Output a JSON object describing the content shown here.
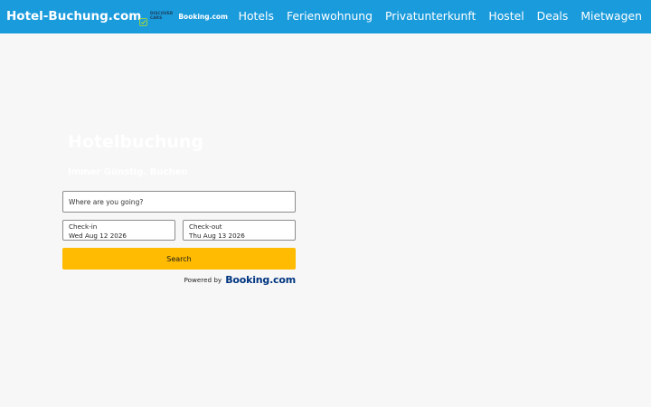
{
  "header": {
    "brand": "Hotel-Buchung.com",
    "partner_logo": {
      "discover_line1": "DISCOVER",
      "discover_line2": "CARS",
      "booking_word": "Booking",
      "booking_suffix": ".com"
    },
    "nav": [
      {
        "label": "Hotels"
      },
      {
        "label": "Ferienwohnung"
      },
      {
        "label": "Privatunterkunft"
      },
      {
        "label": "Hostel"
      },
      {
        "label": "Deals"
      },
      {
        "label": "Mietwagen"
      }
    ],
    "colors": {
      "bar": "#1a9bdc",
      "text": "#ffffff"
    }
  },
  "hero": {
    "title": "Hotelbuchung",
    "subtitle": "Immer Günstig. Buchen"
  },
  "search_form": {
    "destination": {
      "placeholder": "Where are you going?",
      "value": ""
    },
    "checkin": {
      "label": "Check-in",
      "value": "Wed Aug 12 2026"
    },
    "checkout": {
      "label": "Check-out",
      "value": "Thu Aug 13 2026"
    },
    "submit_label": "Search",
    "button_color": "#febb02"
  },
  "powered_by": {
    "text": "Powered by",
    "brand_word": "Booking",
    "brand_suffix": ".com",
    "brand_color": "#003580"
  }
}
